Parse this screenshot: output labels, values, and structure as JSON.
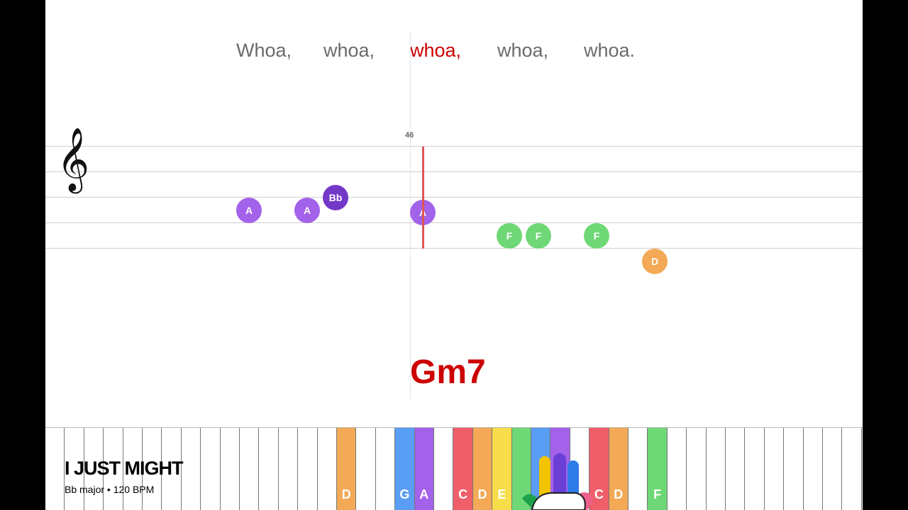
{
  "song": {
    "title": "I JUST MIGHT",
    "info": "Bb major • 120 BPM"
  },
  "lyrics": [
    {
      "text": "Whoa,",
      "active": false
    },
    {
      "text": "whoa,",
      "active": false
    },
    {
      "text": "whoa,",
      "active": true
    },
    {
      "text": "whoa,",
      "active": false
    },
    {
      "text": "whoa.",
      "active": false
    }
  ],
  "measure_number": "46",
  "clef_icon": "treble-clef-icon",
  "notes": [
    {
      "label": "A",
      "color": "#a362ea"
    },
    {
      "label": "A",
      "color": "#a362ea"
    },
    {
      "label": "Bb",
      "color": "#7438c9"
    },
    {
      "label": "A",
      "color": "#a362ea"
    },
    {
      "label": "F",
      "color": "#6fd876"
    },
    {
      "label": "F",
      "color": "#6fd876"
    },
    {
      "label": "F",
      "color": "#6fd876"
    },
    {
      "label": "D",
      "color": "#f3a955"
    }
  ],
  "chord": "Gm7",
  "keyboard": {
    "highlighted_keys": [
      {
        "label": "D",
        "color": "#f3a955"
      },
      {
        "label": "G",
        "color": "#5a9df5"
      },
      {
        "label": "A",
        "color": "#a362ea"
      },
      {
        "label": "C",
        "color": "#ee5f6a"
      },
      {
        "label": "D",
        "color": "#f3a955"
      },
      {
        "label": "E",
        "color": "#f7dd4a"
      },
      {
        "label": "",
        "color": "#6fd876"
      },
      {
        "label": "",
        "color": "#5a9df5"
      },
      {
        "label": "",
        "color": "#a362ea"
      },
      {
        "label": "C",
        "color": "#ee5f6a"
      },
      {
        "label": "D",
        "color": "#f3a955"
      },
      {
        "label": "F",
        "color": "#6fd876"
      }
    ]
  },
  "hand_icon": "hand-icon"
}
